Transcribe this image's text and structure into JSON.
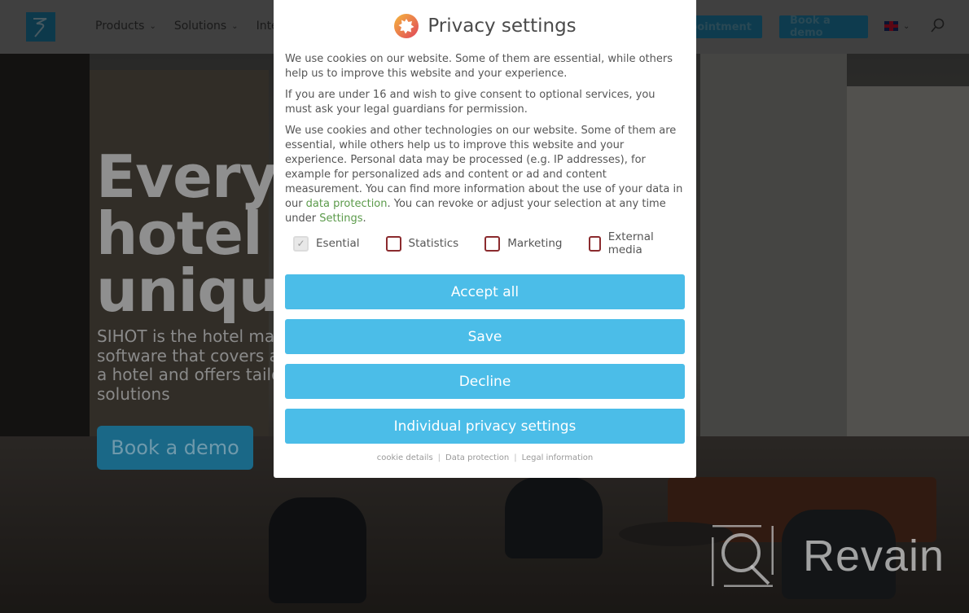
{
  "header": {
    "logo_alt": "SIHOT logo",
    "nav": [
      {
        "label": "Products"
      },
      {
        "label": "Solutions"
      },
      {
        "label": "Inte"
      }
    ],
    "appointment_button": "pointment",
    "book_demo_button": "Book a demo",
    "language": "en-GB",
    "icons": {
      "flag": "uk-flag-icon",
      "search": "search-icon",
      "chevron": "chevron-down-icon"
    }
  },
  "hero": {
    "title_lines": [
      "Every",
      "hotel i",
      "uniqu"
    ],
    "subtitle_lines": [
      "SIHOT is the hotel mana",
      "software that covers all",
      "a hotel and offers tailor",
      "solutions"
    ],
    "cta": "Book a demo"
  },
  "modal": {
    "title": "Privacy settings",
    "icon": "cookie-consent-icon",
    "paragraph1": "We use cookies on our website. Some of them are essential, while others help us to improve this website and your experience.",
    "paragraph2": "If you are under 16 and wish to give consent to optional services, you must ask your legal guardians for permission.",
    "paragraph3_before": "We use cookies and other technologies on our website. Some of them are essential, while others help us to improve this website and your experience. Personal data may be processed (e.g. IP addresses), for example for personalized ads and content or ad and content measurement. You can find more information about the use of your data in our ",
    "paragraph3_link1": "data protection",
    "paragraph3_middle": ". You can revoke or adjust your selection at any time under ",
    "paragraph3_link2": "Settings",
    "paragraph3_end": ".",
    "checkboxes": [
      {
        "label": "Esential",
        "checked": true,
        "disabled": true
      },
      {
        "label": "Statistics",
        "checked": false,
        "disabled": false
      },
      {
        "label": "Marketing",
        "checked": false,
        "disabled": false
      },
      {
        "label": "External media",
        "checked": false,
        "disabled": false
      }
    ],
    "buttons": {
      "accept_all": "Accept all",
      "save": "Save",
      "decline": "Decline",
      "individual": "Individual privacy settings"
    },
    "footer_links": [
      "cookie details",
      "Data protection",
      "Legal information"
    ],
    "footer_separator": "|"
  },
  "watermark": {
    "text": "Revain"
  },
  "colors": {
    "button_blue": "#4bbde8",
    "link_green": "#5b9a4a",
    "checkbox_border": "#8b2b2e",
    "brand_blue": "#1e7fa6"
  }
}
